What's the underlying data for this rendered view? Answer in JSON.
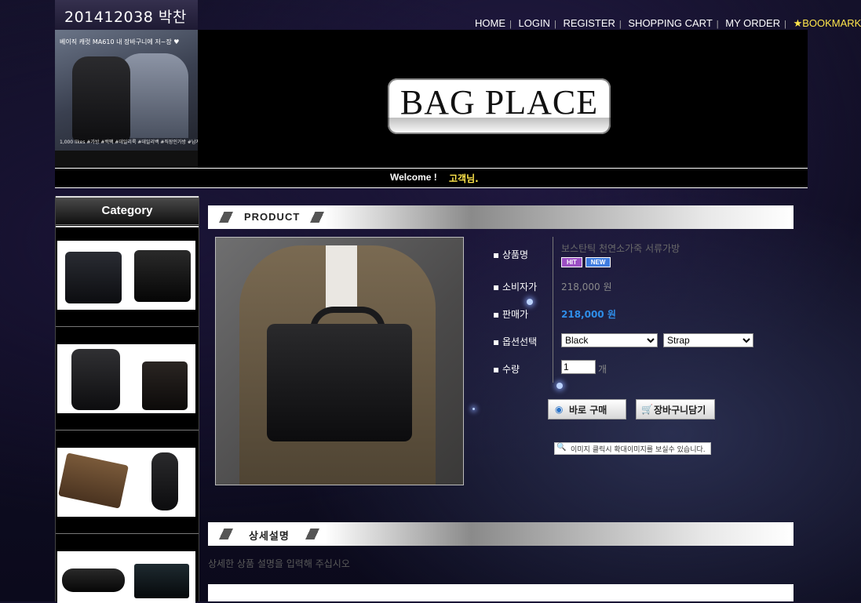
{
  "header": {
    "title": "201412038 박찬형"
  },
  "nav": {
    "items": [
      "HOME",
      "LOGIN",
      "REGISTER",
      "SHOPPING CART",
      "MY ORDER"
    ],
    "bookmark": "★BOOKMARK"
  },
  "banner": {
    "caption": "베이직 캐럿 MA610 내 장바구니에 저~장 ♥",
    "caption2": "1,000 likes  #가방  #백팩  #데일리룩  #데일리백  #직장인가방  #남자가방"
  },
  "logo": {
    "text": "BAG PLACE"
  },
  "welcome": {
    "text": "Welcome !",
    "guest": "고객님."
  },
  "sidebar": {
    "heading": "Category"
  },
  "product": {
    "section_label": "PRODUCT",
    "name_label": "상품명",
    "name": "보스탄틱 천연소가죽 서류가방",
    "badges": [
      "HIT",
      "NEW"
    ],
    "consumer_price_label": "소비자가",
    "consumer_price": "218,000 원",
    "sale_price_label": "판매가",
    "sale_price": "218,000 원",
    "option_label": "옵션선택",
    "option1_value": "Black",
    "option2_value": "Strap",
    "qty_label": "수량",
    "qty_value": "1",
    "qty_unit": "개",
    "buy_now": "바로 구매",
    "add_cart": "장바구니담기",
    "zoom_note": "이미지 클릭시 확대이미지를 보실수 있습니다."
  },
  "detail": {
    "section_label": "상세설명",
    "text": "상세한 상품 설명을 입력해 주십시오"
  },
  "colors": {
    "accent_yellow": "#ffe64b",
    "sale_price": "#2f8ee8",
    "hit_badge": "#9b4fc3",
    "new_badge": "#3f7ce0"
  }
}
